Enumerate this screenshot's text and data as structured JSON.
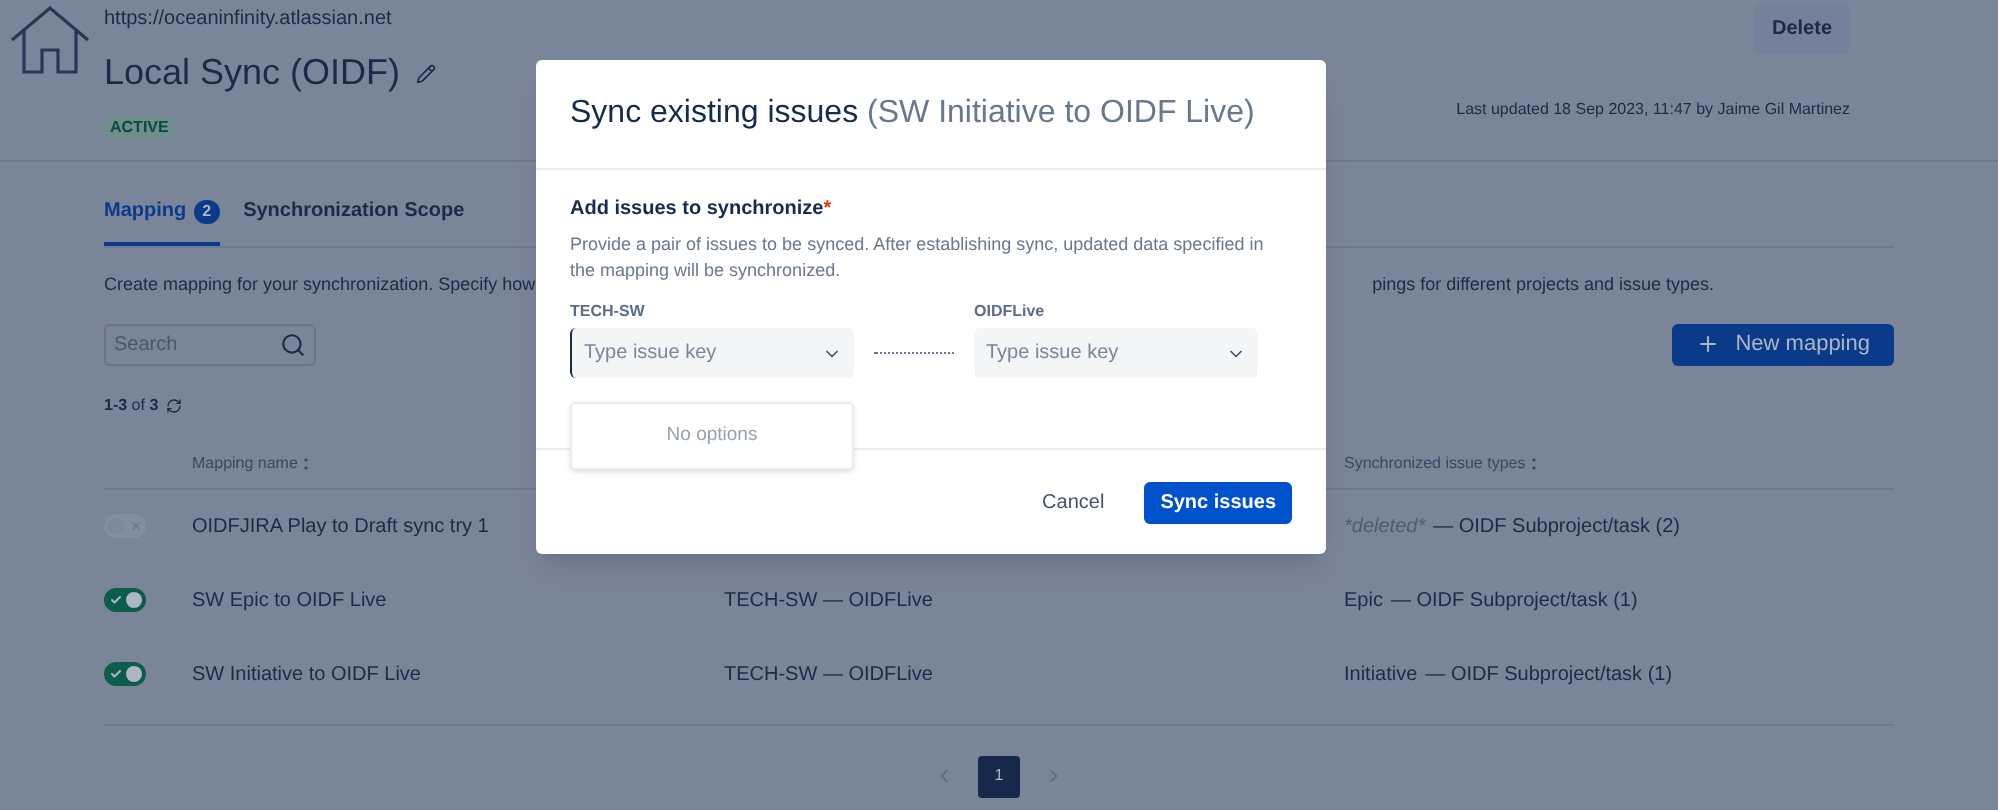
{
  "header": {
    "url": "https://oceaninfinity.atlassian.net",
    "title": "Local Sync (OIDF)",
    "status": "ACTIVE",
    "delete_button": "Delete",
    "last_updated": "Last updated 18 Sep 2023, 11:47 by Jaime Gil Martinez"
  },
  "tabs": [
    {
      "label": "Mapping",
      "badge": "2",
      "selected": true
    },
    {
      "label": "Synchronization Scope",
      "selected": false
    }
  ],
  "description": {
    "part_1": "Create mapping for your synchronization. Specify how",
    "part_2": "pings for different projects and issue types."
  },
  "search": {
    "placeholder": "Search"
  },
  "new_mapping_button": "New mapping",
  "result_count": {
    "range": "1-3",
    "of": "of",
    "total": "3"
  },
  "table": {
    "columns": [
      {
        "label": "Mapping name"
      },
      {
        "label": "Synchronized issue types"
      }
    ],
    "rows": [
      {
        "enabled": false,
        "name": "OIDFJIRA Play to Draft sync try 1",
        "source_type": "*deleted*",
        "source_deleted": true,
        "target_type": "— OIDF Subproject/task (2)"
      },
      {
        "enabled": true,
        "name": "SW Epic to OIDF Live",
        "projects": "TECH-SW — OIDFLive",
        "source_type": "Epic",
        "source_deleted": false,
        "target_type": "— OIDF Subproject/task (1)"
      },
      {
        "enabled": true,
        "name": "SW Initiative to OIDF Live",
        "projects": "TECH-SW — OIDFLive",
        "source_type": "Initiative",
        "source_deleted": false,
        "target_type": "— OIDF Subproject/task (1)"
      }
    ]
  },
  "pagination": [
    {
      "label": "1",
      "selected": true
    }
  ],
  "modal": {
    "title": "Sync existing issues",
    "subtitle": "(SW Initiative to OIDF Live)",
    "section_label": "Add issues to synchronize",
    "required_mark": "*",
    "help": "Provide a pair of issues to be synced. After establishing sync, updated data specified in the mapping will be synchronized.",
    "fields": [
      {
        "label": "TECH-SW",
        "placeholder": "Type issue key",
        "focused": true
      },
      {
        "label": "OIDFLive",
        "placeholder": "Type issue key",
        "focused": false
      }
    ],
    "dropdown_message": "No options",
    "cancel_button": "Cancel",
    "submit_button": "Sync issues"
  }
}
